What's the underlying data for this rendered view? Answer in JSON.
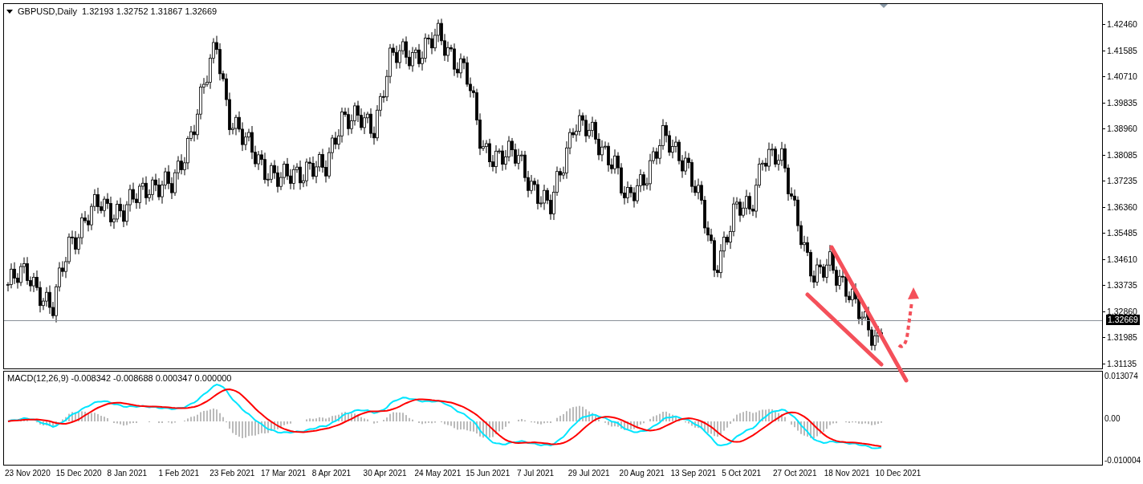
{
  "chart_header": {
    "symbol": "GBPUSD,Daily",
    "ohlc": "1.32193 1.32752 1.31867 1.32669"
  },
  "price_axis": {
    "labels": [
      "1.42460",
      "1.41585",
      "1.40710",
      "1.39835",
      "1.38960",
      "1.38085",
      "1.37235",
      "1.36360",
      "1.35485",
      "1.34610",
      "1.33735",
      "1.32860",
      "1.31985",
      "1.31135"
    ],
    "current_price": "1.32669"
  },
  "macd": {
    "header": "MACD(12,26,9) -0.008342 -0.008688 0.000347 0.000000",
    "axis_labels": [
      "0.013074",
      "0.00",
      "-0.010004"
    ]
  },
  "time_axis": {
    "labels": [
      "23 Nov 2020",
      "15 Dec 2020",
      "8 Jan 2021",
      "1 Feb 2021",
      "23 Feb 2021",
      "17 Mar 2021",
      "8 Apr 2021",
      "30 Apr 2021",
      "24 May 2021",
      "15 Jun 2021",
      "7 Jul 2021",
      "29 Jul 2021",
      "20 Aug 2021",
      "13 Sep 2021",
      "5 Oct 2021",
      "27 Oct 2021",
      "18 Nov 2021",
      "10 Dec 2021"
    ]
  }
}
